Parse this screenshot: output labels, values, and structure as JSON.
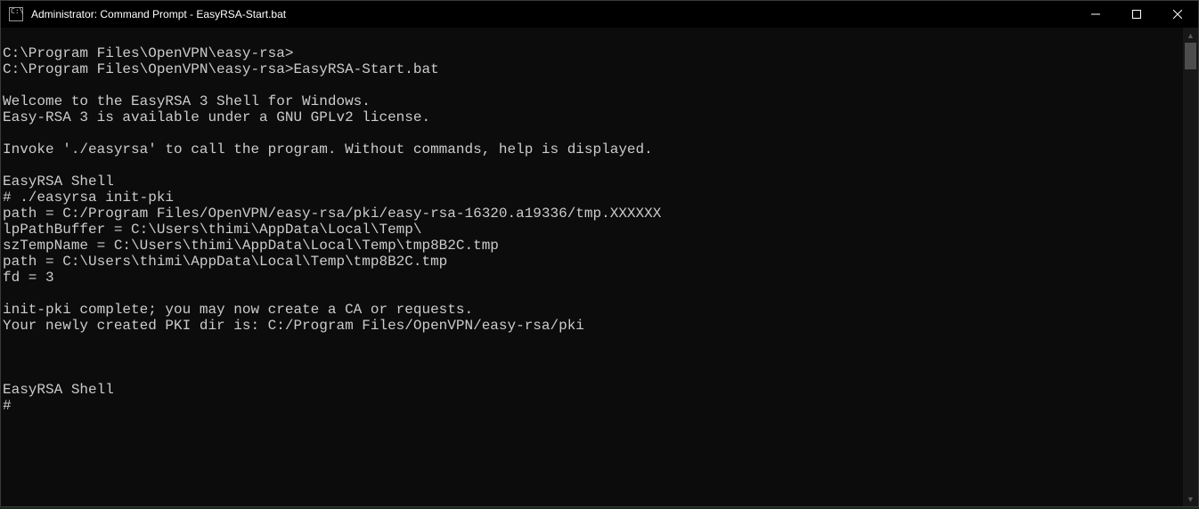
{
  "window": {
    "title": "Administrator: Command Prompt - EasyRSA-Start.bat"
  },
  "terminal": {
    "lines": [
      "",
      "C:\\Program Files\\OpenVPN\\easy-rsa>",
      "C:\\Program Files\\OpenVPN\\easy-rsa>EasyRSA-Start.bat",
      "",
      "Welcome to the EasyRSA 3 Shell for Windows.",
      "Easy-RSA 3 is available under a GNU GPLv2 license.",
      "",
      "Invoke './easyrsa' to call the program. Without commands, help is displayed.",
      "",
      "EasyRSA Shell",
      "# ./easyrsa init-pki",
      "path = C:/Program Files/OpenVPN/easy-rsa/pki/easy-rsa-16320.a19336/tmp.XXXXXX",
      "lpPathBuffer = C:\\Users\\thimi\\AppData\\Local\\Temp\\",
      "szTempName = C:\\Users\\thimi\\AppData\\Local\\Temp\\tmp8B2C.tmp",
      "path = C:\\Users\\thimi\\AppData\\Local\\Temp\\tmp8B2C.tmp",
      "fd = 3",
      "",
      "init-pki complete; you may now create a CA or requests.",
      "Your newly created PKI dir is: C:/Program Files/OpenVPN/easy-rsa/pki",
      "",
      "",
      "",
      "EasyRSA Shell",
      "#"
    ]
  }
}
